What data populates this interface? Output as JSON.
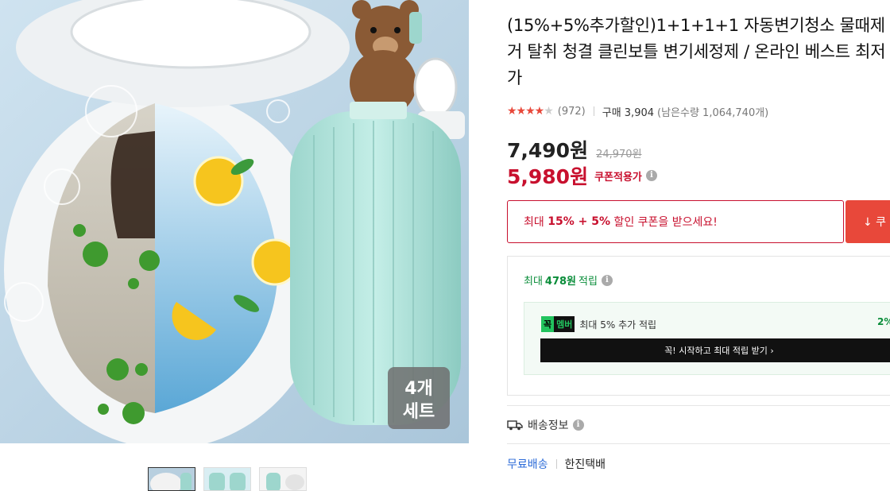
{
  "product": {
    "title": "(15%+5%추가할인)1+1+1+1 자동변기청소 물때제거 탈취 청결 클린보틀 변기세정제 / 온라인 베스트 최저가",
    "rating_stars": 4,
    "review_count": "(972)",
    "purchase_label": "구매 3,904",
    "remaining": "(남은수량 1,064,740개)",
    "price": "7,490원",
    "original_price": "24,970원",
    "coupon_price": "5,980원",
    "coupon_label": "쿠폰적용가",
    "image_badge": "4개\n세트"
  },
  "coupon": {
    "text_prefix": "최대 ",
    "text_bold": "15% + 5%",
    "text_suffix": " 할인 쿠폰을 받으세요!",
    "download_label": "↓ 쿠"
  },
  "points": {
    "prefix": "최대",
    "amount": "478원",
    "suffix": "적립",
    "member_badge_a": "꼭",
    "member_badge_b": "멤버",
    "member_text": "최대 5% 추가 적립",
    "member_right": "2%",
    "start_label": "꼭! 시작하고 최대 적립 받기 ›"
  },
  "shipping": {
    "header": "배송정보",
    "free_label": "무료배송",
    "carrier": "한진택배"
  },
  "icons": {
    "star": "star-icon",
    "info": "info-icon",
    "truck": "truck-icon",
    "download": "download-icon"
  },
  "colors": {
    "accent_red": "#c8102e",
    "star_red": "#e8483a",
    "green": "#0a8d3a",
    "link_blue": "#2c6bd8"
  }
}
